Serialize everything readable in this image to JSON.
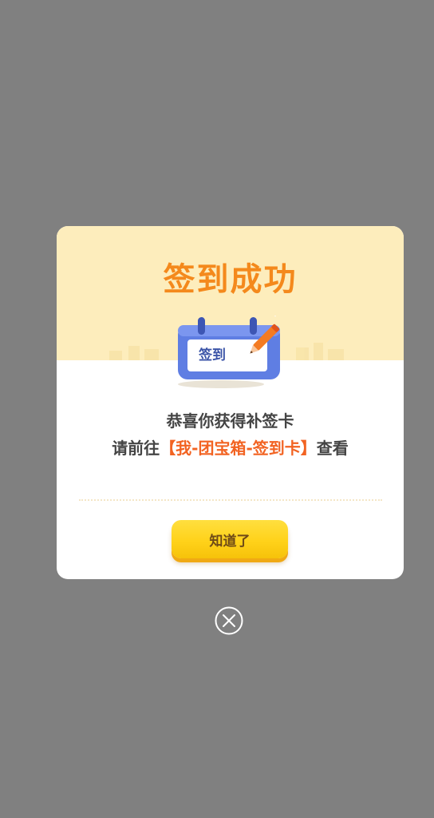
{
  "dialog": {
    "title": "签到成功",
    "calendar_label": "签到",
    "message_line1": "恭喜你获得补签卡",
    "message_line2_prefix": "请前往",
    "message_line2_highlight": "【我-团宝箱-签到卡】",
    "message_line2_suffix": "查看",
    "confirm_label": "知道了"
  },
  "icons": {
    "close": "close-circle-icon",
    "calendar": "calendar-icon",
    "pencil": "pencil-icon",
    "sparkle": "sparkle-icon"
  },
  "colors": {
    "overlay": "#808080",
    "header_bg": "#fdedbc",
    "title": "#f4891c",
    "highlight": "#f26322",
    "button": "#ffd21a",
    "button_text": "#6e4a17"
  }
}
